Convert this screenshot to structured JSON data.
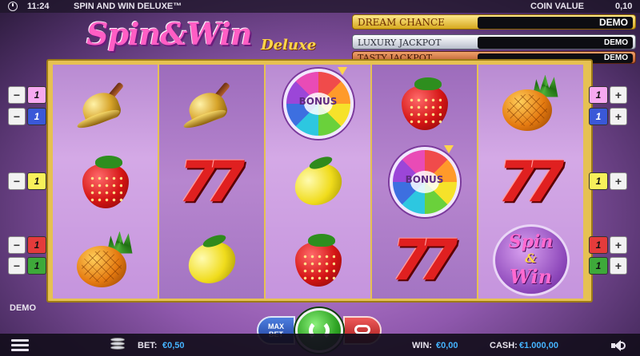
{
  "status_bar": {
    "time": "11:24",
    "game_title": "SPIN AND WIN DELUXE™",
    "coin_value_label": "COIN VALUE",
    "coin_value": "0,10"
  },
  "logo": {
    "main": "Spin&Win",
    "sub": "Deluxe"
  },
  "jackpots": [
    {
      "name": "DREAM CHANCE JACKPOT",
      "value": "DEMO"
    },
    {
      "name": "LUXURY JACKPOT",
      "value": "DEMO"
    },
    {
      "name": "TASTY JACKPOT",
      "value": "DEMO"
    }
  ],
  "reels": [
    [
      "bell",
      "strawberry",
      "pineapple"
    ],
    [
      "bell",
      "seven",
      "lemon"
    ],
    [
      "bonus-wheel",
      "lemon",
      "strawberry"
    ],
    [
      "strawberry",
      "bonus-wheel",
      "seven"
    ],
    [
      "pineapple",
      "seven",
      "spin-win"
    ]
  ],
  "symbol_text": {
    "bonus": "BONUS",
    "seven": "7",
    "spinwin_1": "Spin",
    "spinwin_2": "&",
    "spinwin_3": "Win"
  },
  "paylines": {
    "left": [
      {
        "number": "1",
        "color": "#f6a9f0",
        "minus": "−"
      },
      {
        "number": "1",
        "color": "#3a58d8",
        "minus": "−"
      },
      {
        "number": "1",
        "color": "#f7f05a",
        "minus": "−"
      },
      {
        "number": "1",
        "color": "#e43b3b",
        "minus": "−"
      },
      {
        "number": "1",
        "color": "#3ea93a",
        "minus": "−"
      }
    ],
    "right": [
      {
        "number": "1",
        "color": "#f6a9f0",
        "plus": "+"
      },
      {
        "number": "1",
        "color": "#3a58d8",
        "plus": "+"
      },
      {
        "number": "1",
        "color": "#f7f05a",
        "plus": "+"
      },
      {
        "number": "1",
        "color": "#e43b3b",
        "plus": "+"
      },
      {
        "number": "1",
        "color": "#3ea93a",
        "plus": "+"
      }
    ]
  },
  "demo_label": "DEMO",
  "controls": {
    "max_bet_1": "MAX",
    "max_bet_2": "BET"
  },
  "bottom_bar": {
    "bet_label": "BET:",
    "bet_value": "€0,50",
    "win_label": "WIN:",
    "win_value": "€0,00",
    "cash_label": "CASH:",
    "cash_value": "€1.000,00"
  }
}
